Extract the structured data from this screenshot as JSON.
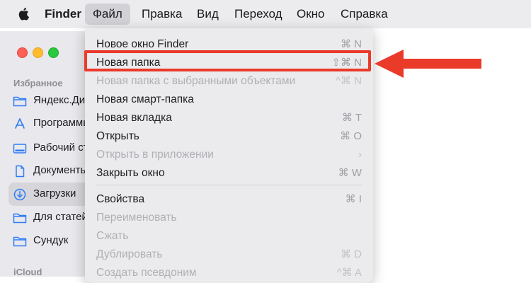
{
  "menubar": {
    "app_name": "Finder",
    "items": [
      "Файл",
      "Правка",
      "Вид",
      "Переход",
      "Окно",
      "Справка"
    ]
  },
  "sidebar": {
    "favorites_title": "Избранное",
    "items": [
      {
        "label": "Яндекс.Диск",
        "icon": "folder-icon"
      },
      {
        "label": "Программы",
        "icon": "applications-icon"
      },
      {
        "label": "Рабочий стол",
        "icon": "desktop-icon"
      },
      {
        "label": "Документы",
        "icon": "document-icon"
      },
      {
        "label": "Загрузки",
        "icon": "downloads-icon",
        "selected": true
      },
      {
        "label": "Для статей",
        "icon": "folder-icon"
      },
      {
        "label": "Сундук",
        "icon": "folder-icon"
      }
    ],
    "icloud_title": "iCloud"
  },
  "file_menu": {
    "items": [
      {
        "label": "Новое окно Finder",
        "shortcut": "⌘ N",
        "enabled": true
      },
      {
        "label": "Новая папка",
        "shortcut": "⇧⌘ N",
        "enabled": true
      },
      {
        "label": "Новая папка с выбранными объектами",
        "shortcut": "^⌘ N",
        "enabled": false
      },
      {
        "label": "Новая смарт-папка",
        "shortcut": "",
        "enabled": true
      },
      {
        "label": "Новая вкладка",
        "shortcut": "⌘ T",
        "enabled": true
      },
      {
        "label": "Открыть",
        "shortcut": "⌘ O",
        "enabled": true
      },
      {
        "label": "Открыть в приложении",
        "shortcut": "›",
        "enabled": false
      },
      {
        "label": "Закрыть окно",
        "shortcut": "⌘ W",
        "enabled": true
      },
      {
        "label": "Свойства",
        "shortcut": "⌘ I",
        "enabled": true
      },
      {
        "label": "Переименовать",
        "shortcut": "",
        "enabled": false
      },
      {
        "label": "Сжать",
        "shortcut": "",
        "enabled": false
      },
      {
        "label": "Дублировать",
        "shortcut": "⌘ D",
        "enabled": false
      },
      {
        "label": "Создать псевдоним",
        "shortcut": "^⌘ A",
        "enabled": false
      }
    ]
  },
  "annotation": {
    "color": "#ea3a2a"
  }
}
